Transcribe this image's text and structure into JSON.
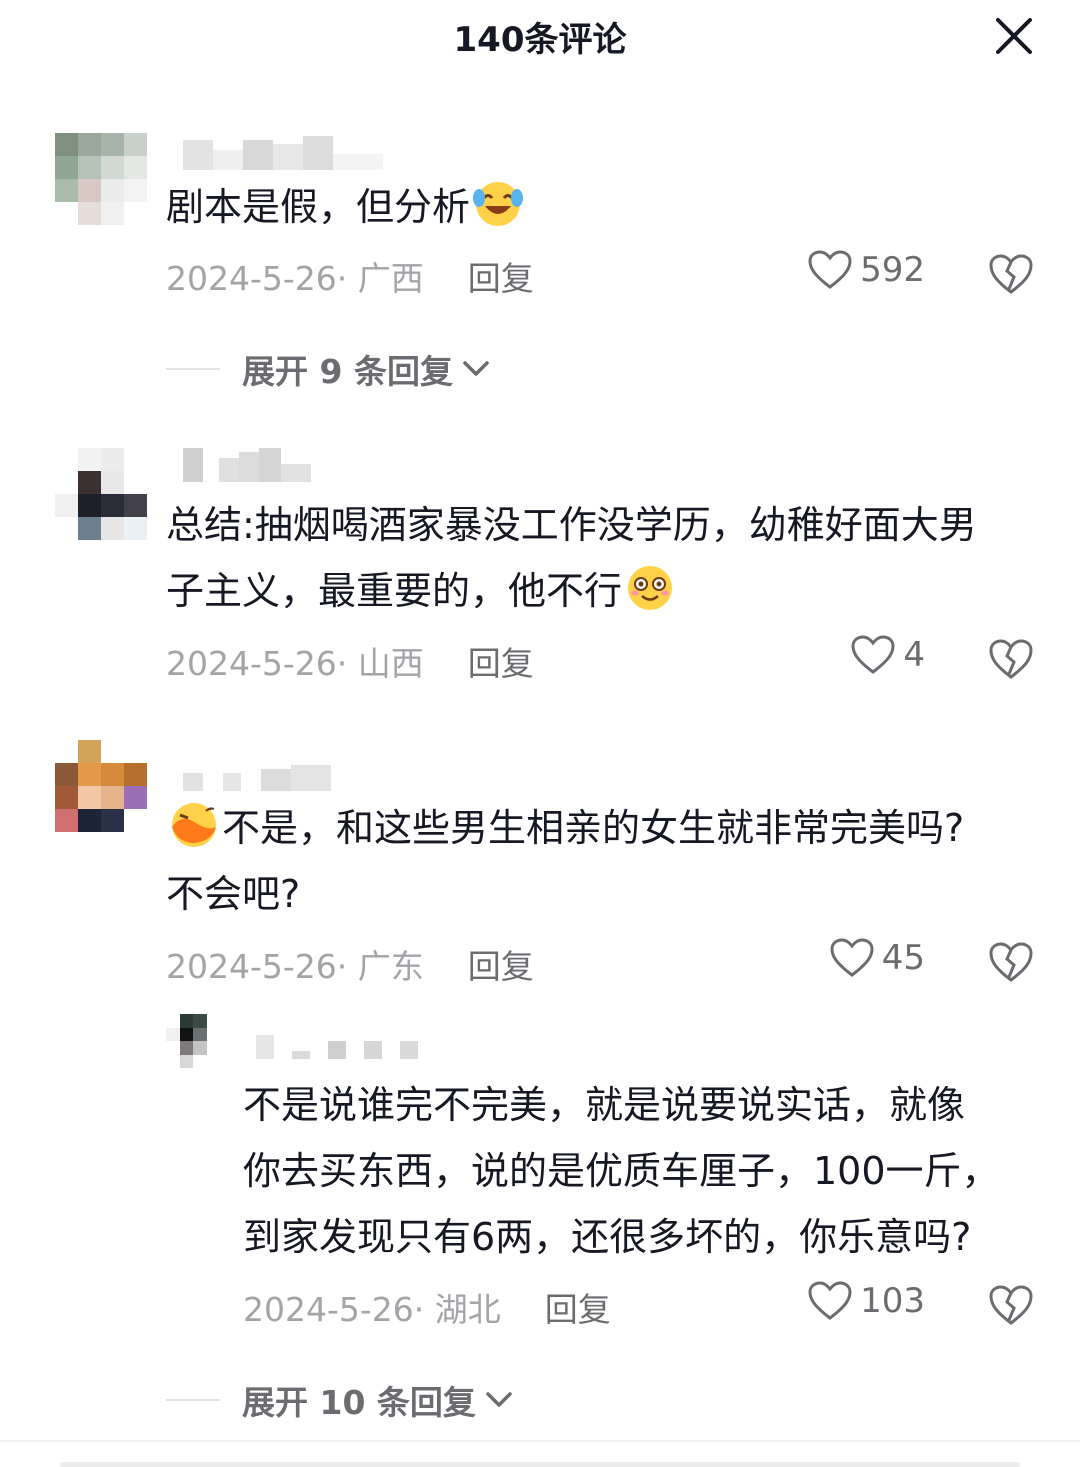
{
  "header": {
    "title": "140条评论",
    "close_icon": "close-icon"
  },
  "comments": [
    {
      "text_lines": [
        "剧本是假，但分析"
      ],
      "emoji": "laugh-cry-emoji",
      "date": "2024-5-26",
      "location": "· 广西",
      "reply": "回复",
      "likes": "592",
      "expand": "展开 9 条回复"
    },
    {
      "text_lines": [
        "总结:抽烟喝酒家暴没工作没学历，幼稚好面大男",
        "子主义，最重要的，他不行"
      ],
      "emoji": "smile-emoji",
      "date": "2024-5-26",
      "location": "· 山西",
      "reply": "回复",
      "likes": "4"
    },
    {
      "text_lines": [
        "不是，和这些男生相亲的女生就非常完美吗?",
        "不会吧?"
      ],
      "emoji": "duck-lips-emoji",
      "date": "2024-5-26",
      "location": "· 广东",
      "reply": "回复",
      "likes": "45",
      "subreply": {
        "text_lines": [
          "不是说谁完不完美，就是说要说实话，就像",
          "你去买东西，说的是优质车厘子，100一斤，",
          "到家发现只有6两，还很多坏的，你乐意吗?"
        ],
        "date": "2024-5-26",
        "location": "· 湖北",
        "reply": "回复",
        "likes": "103"
      },
      "expand": "展开 10 条回复"
    }
  ],
  "colors": {
    "text": "#161823",
    "meta": "#a3a4a8",
    "action": "#6b6c70"
  },
  "icons": [
    "heart-outline-icon",
    "broken-heart-icon",
    "chevron-down-icon"
  ]
}
